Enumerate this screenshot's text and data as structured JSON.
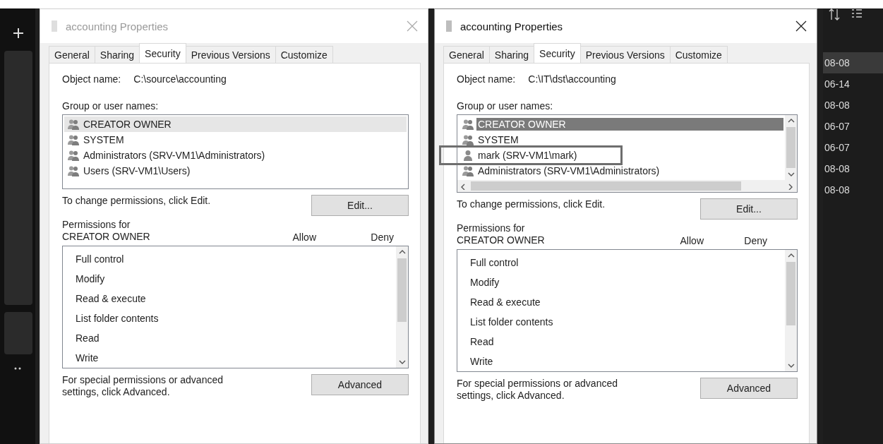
{
  "sidebar": {
    "items": [
      {
        "kind": "add"
      },
      {
        "kind": "card"
      },
      {
        "kind": "card"
      },
      {
        "kind": "more"
      }
    ]
  },
  "dialogs": [
    {
      "title": "accounting Properties",
      "active": false,
      "tabs": [
        {
          "label": "General",
          "selected": false
        },
        {
          "label": "Sharing",
          "selected": false
        },
        {
          "label": "Security",
          "selected": true
        },
        {
          "label": "Previous Versions",
          "selected": false
        },
        {
          "label": "Customize",
          "selected": false
        }
      ],
      "object_label": "Object name:",
      "object_name": "C:\\source\\accounting",
      "groups_label": "Group or user names:",
      "groups_scrollbars": false,
      "groups": [
        {
          "name": "CREATOR OWNER",
          "kind": "group",
          "selected": true,
          "annotated": false
        },
        {
          "name": "SYSTEM",
          "kind": "group",
          "selected": false,
          "annotated": false
        },
        {
          "name": "Administrators (SRV-VM1\\Administrators)",
          "kind": "group",
          "selected": false,
          "annotated": false
        },
        {
          "name": "Users (SRV-VM1\\Users)",
          "kind": "group",
          "selected": false,
          "annotated": false
        }
      ],
      "change_text": "To change permissions, click Edit.",
      "edit_button": "Edit...",
      "permissions_label": "Permissions for CREATOR OWNER",
      "allow_header": "Allow",
      "deny_header": "Deny",
      "permissions": [
        "Full control",
        "Modify",
        "Read & execute",
        "List folder contents",
        "Read",
        "Write"
      ],
      "advanced_text": "For special permissions or advanced settings, click Advanced.",
      "advanced_button": "Advanced"
    },
    {
      "title": "accounting Properties",
      "active": true,
      "tabs": [
        {
          "label": "General",
          "selected": false
        },
        {
          "label": "Sharing",
          "selected": false
        },
        {
          "label": "Security",
          "selected": true
        },
        {
          "label": "Previous Versions",
          "selected": false
        },
        {
          "label": "Customize",
          "selected": false
        }
      ],
      "object_label": "Object name:",
      "object_name": "C:\\IT\\dst\\accounting",
      "groups_label": "Group or user names:",
      "groups_scrollbars": true,
      "groups": [
        {
          "name": "CREATOR OWNER",
          "kind": "group",
          "selected": true,
          "annotated": false
        },
        {
          "name": "SYSTEM",
          "kind": "group",
          "selected": false,
          "annotated": false
        },
        {
          "name": "mark (SRV-VM1\\mark)",
          "kind": "user",
          "selected": false,
          "annotated": true
        },
        {
          "name": "Administrators (SRV-VM1\\Administrators)",
          "kind": "group",
          "selected": false,
          "annotated": false
        }
      ],
      "change_text": "To change permissions, click Edit.",
      "edit_button": "Edit...",
      "permissions_label": "Permissions for CREATOR OWNER",
      "allow_header": "Allow",
      "deny_header": "Deny",
      "permissions": [
        "Full control",
        "Modify",
        "Read & execute",
        "List folder contents",
        "Read",
        "Write"
      ],
      "advanced_text": "For special permissions or advanced settings, click Advanced.",
      "advanced_button": "Advanced"
    }
  ],
  "right_panel": {
    "dates": [
      {
        "text": "08-08",
        "selected": true
      },
      {
        "text": "06-14",
        "selected": false
      },
      {
        "text": "08-08",
        "selected": false
      },
      {
        "text": "06-07",
        "selected": false
      },
      {
        "text": "06-07",
        "selected": false
      },
      {
        "text": "08-08",
        "selected": false
      },
      {
        "text": "08-08",
        "selected": false
      }
    ]
  }
}
